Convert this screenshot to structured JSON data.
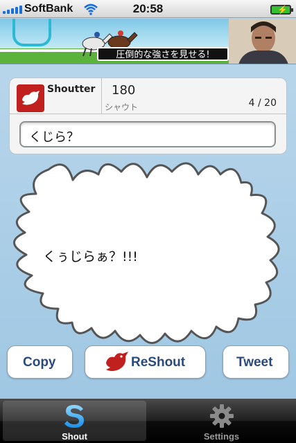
{
  "status_bar": {
    "carrier": "SoftBank",
    "time": "20:58",
    "icons": [
      "signal-icon",
      "wifi-icon",
      "battery-charging-icon"
    ]
  },
  "ad": {
    "caption": "圧倒的な強さを見せる!"
  },
  "card": {
    "app_name": "Shoutter",
    "count": "180",
    "count_label": "シャウト",
    "page_indicator": "4 / 20",
    "input_value": "くじら？"
  },
  "bubble": {
    "text": "くぅじらぁ？!!!"
  },
  "actions": {
    "copy": "Copy",
    "reshout": "ReShout",
    "tweet": "Tweet"
  },
  "tabs": [
    {
      "label": "Shout",
      "icon": "shout-s-icon",
      "selected": true
    },
    {
      "label": "Settings",
      "icon": "gear-icon",
      "selected": false
    }
  ],
  "colors": {
    "accent_red": "#c0201e",
    "button_text": "#2a4a7e",
    "background": "#a9cde6"
  }
}
